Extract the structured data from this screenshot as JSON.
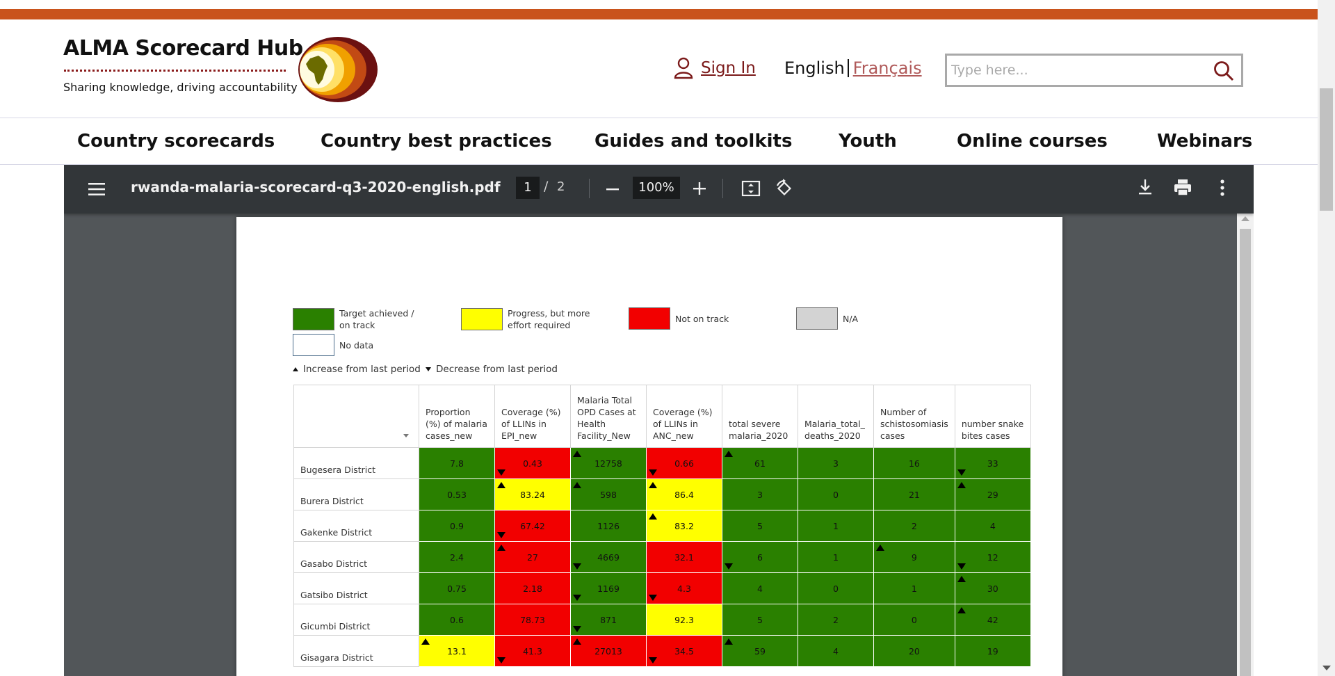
{
  "header": {
    "logo_title": "ALMA Scorecard Hub",
    "logo_tagline": "Sharing knowledge, driving accountability",
    "signin_label": "Sign In",
    "lang_current": "English",
    "lang_other": "Français",
    "search_placeholder": "Type here..."
  },
  "nav": {
    "items": [
      "Country scorecards",
      "Country best practices",
      "Guides and toolkits",
      "Youth",
      "Online courses",
      "Webinars"
    ]
  },
  "viewer": {
    "file_name": "rwanda-malaria-scorecard-q3-2020-english.pdf",
    "current_page": "1",
    "page_separator": "/",
    "total_pages": "2",
    "zoom": "100%"
  },
  "legend": {
    "on_track": "Target achieved / on track",
    "progress": "Progress, but more effort required",
    "not_on_track": "Not on track",
    "na": "N/A",
    "no_data": "No data",
    "increase": "Increase from last period",
    "decrease": "Decrease from last period",
    "colors": {
      "green": "#2a8000",
      "yellow": "#ffff00",
      "red": "#f20000",
      "grey": "#d3d3d3"
    }
  },
  "table": {
    "headers": [
      "",
      "Proportion (%) of malaria cases_new",
      "Coverage (%) of LLINs in EPI_new",
      "Malaria Total OPD Cases at Health Facility_New",
      "Coverage (%) of LLINs in ANC_new",
      "total severe malaria_2020",
      "Malaria_total_ deaths_2020",
      "Number of schistosomiasis cases",
      "number snake bites cases"
    ],
    "rows": [
      {
        "district": "Bugesera District",
        "cells": [
          {
            "v": "7.8",
            "c": "green",
            "a": ""
          },
          {
            "v": "0.43",
            "c": "red",
            "a": "down"
          },
          {
            "v": "12758",
            "c": "green",
            "a": "up"
          },
          {
            "v": "0.66",
            "c": "red",
            "a": "down"
          },
          {
            "v": "61",
            "c": "green",
            "a": "up"
          },
          {
            "v": "3",
            "c": "green",
            "a": ""
          },
          {
            "v": "16",
            "c": "green",
            "a": ""
          },
          {
            "v": "33",
            "c": "green",
            "a": "down"
          }
        ]
      },
      {
        "district": "Burera District",
        "cells": [
          {
            "v": "0.53",
            "c": "green",
            "a": ""
          },
          {
            "v": "83.24",
            "c": "yellow",
            "a": "up"
          },
          {
            "v": "598",
            "c": "green",
            "a": "up"
          },
          {
            "v": "86.4",
            "c": "yellow",
            "a": "up"
          },
          {
            "v": "3",
            "c": "green",
            "a": ""
          },
          {
            "v": "0",
            "c": "green",
            "a": ""
          },
          {
            "v": "21",
            "c": "green",
            "a": ""
          },
          {
            "v": "29",
            "c": "green",
            "a": "up"
          }
        ]
      },
      {
        "district": "Gakenke District",
        "cells": [
          {
            "v": "0.9",
            "c": "green",
            "a": ""
          },
          {
            "v": "67.42",
            "c": "red",
            "a": "down"
          },
          {
            "v": "1126",
            "c": "green",
            "a": ""
          },
          {
            "v": "83.2",
            "c": "yellow",
            "a": "up"
          },
          {
            "v": "5",
            "c": "green",
            "a": ""
          },
          {
            "v": "1",
            "c": "green",
            "a": ""
          },
          {
            "v": "2",
            "c": "green",
            "a": ""
          },
          {
            "v": "4",
            "c": "green",
            "a": ""
          }
        ]
      },
      {
        "district": "Gasabo District",
        "cells": [
          {
            "v": "2.4",
            "c": "green",
            "a": ""
          },
          {
            "v": "27",
            "c": "red",
            "a": "up"
          },
          {
            "v": "4669",
            "c": "green",
            "a": "down"
          },
          {
            "v": "32.1",
            "c": "red",
            "a": ""
          },
          {
            "v": "6",
            "c": "green",
            "a": "down"
          },
          {
            "v": "1",
            "c": "green",
            "a": ""
          },
          {
            "v": "9",
            "c": "green",
            "a": "up"
          },
          {
            "v": "12",
            "c": "green",
            "a": "down"
          }
        ]
      },
      {
        "district": "Gatsibo District",
        "cells": [
          {
            "v": "0.75",
            "c": "green",
            "a": ""
          },
          {
            "v": "2.18",
            "c": "red",
            "a": ""
          },
          {
            "v": "1169",
            "c": "green",
            "a": "down"
          },
          {
            "v": "4.3",
            "c": "red",
            "a": "down"
          },
          {
            "v": "4",
            "c": "green",
            "a": ""
          },
          {
            "v": "0",
            "c": "green",
            "a": ""
          },
          {
            "v": "1",
            "c": "green",
            "a": ""
          },
          {
            "v": "30",
            "c": "green",
            "a": "up"
          }
        ]
      },
      {
        "district": "Gicumbi District",
        "cells": [
          {
            "v": "0.6",
            "c": "green",
            "a": ""
          },
          {
            "v": "78.73",
            "c": "red",
            "a": ""
          },
          {
            "v": "871",
            "c": "green",
            "a": "down"
          },
          {
            "v": "92.3",
            "c": "yellow",
            "a": ""
          },
          {
            "v": "5",
            "c": "green",
            "a": ""
          },
          {
            "v": "2",
            "c": "green",
            "a": ""
          },
          {
            "v": "0",
            "c": "green",
            "a": ""
          },
          {
            "v": "42",
            "c": "green",
            "a": "up"
          }
        ]
      },
      {
        "district": "Gisagara District",
        "cells": [
          {
            "v": "13.1",
            "c": "yellow",
            "a": "up"
          },
          {
            "v": "41.3",
            "c": "red",
            "a": "down"
          },
          {
            "v": "27013",
            "c": "red",
            "a": "up"
          },
          {
            "v": "34.5",
            "c": "red",
            "a": "down"
          },
          {
            "v": "59",
            "c": "green",
            "a": "up"
          },
          {
            "v": "4",
            "c": "green",
            "a": ""
          },
          {
            "v": "20",
            "c": "green",
            "a": ""
          },
          {
            "v": "19",
            "c": "green",
            "a": ""
          }
        ]
      }
    ]
  }
}
